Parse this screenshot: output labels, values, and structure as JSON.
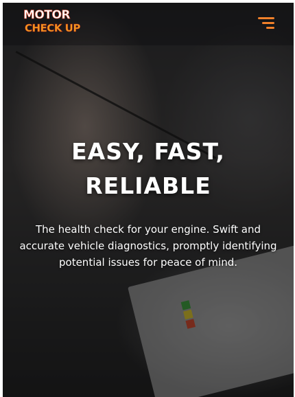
{
  "header": {
    "logo_line1": "MOTOR",
    "logo_line2": "CHECK UP",
    "menu_icon": "hamburger-menu-icon"
  },
  "hero": {
    "title_line1": "EASY, FAST,",
    "title_line2": "RELIABLE",
    "subtitle": "The health check for your engine. Swift and accurate vehicle diagnostics, promptly identifying potential issues for peace of mind."
  },
  "colors": {
    "accent": "#f0802a",
    "logo_red": "#e8462a",
    "logo_orange": "#f39a1e",
    "text": "#ffffff"
  }
}
